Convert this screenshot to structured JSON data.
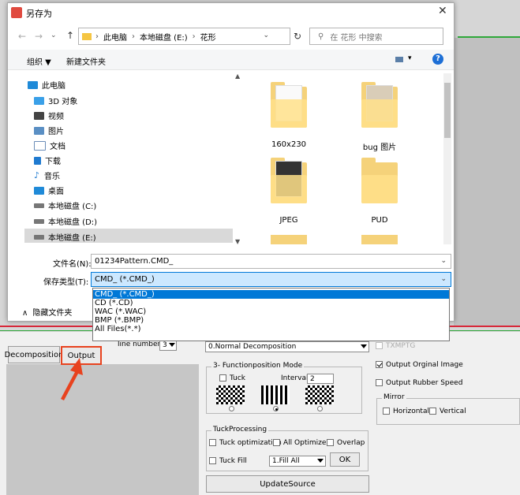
{
  "colors": {
    "accent_red": "#e8421e",
    "selection_blue": "#0078d7",
    "highlight_blue": "#cce8ff"
  },
  "dialog": {
    "title": "另存为",
    "breadcrumb": [
      "此电脑",
      "本地磁盘 (E:)",
      "花形"
    ],
    "search_placeholder": "在 花形 中搜索",
    "toolbar": {
      "organize": "组织 ▼",
      "new_folder": "新建文件夹"
    },
    "nav_items": [
      {
        "label": "此电脑",
        "icon": "computer-icon"
      },
      {
        "label": "3D 对象",
        "icon": "3d-objects-icon"
      },
      {
        "label": "视频",
        "icon": "video-icon"
      },
      {
        "label": "图片",
        "icon": "pictures-icon"
      },
      {
        "label": "文档",
        "icon": "documents-icon"
      },
      {
        "label": "下载",
        "icon": "download-icon"
      },
      {
        "label": "音乐",
        "icon": "music-icon"
      },
      {
        "label": "桌面",
        "icon": "desktop-icon"
      },
      {
        "label": "本地磁盘 (C:)",
        "icon": "drive-icon"
      },
      {
        "label": "本地磁盘 (D:)",
        "icon": "drive-icon"
      },
      {
        "label": "本地磁盘 (E:)",
        "icon": "drive-icon"
      }
    ],
    "folders": [
      {
        "label": "160x230"
      },
      {
        "label": "bug 图片"
      },
      {
        "label": "JPEG"
      },
      {
        "label": "PUD"
      }
    ],
    "filename_label": "文件名(N):",
    "filename_value": "01234Pattern.CMD_",
    "filetype_label": "保存类型(T):",
    "filetype_value": "CMD_ (*.CMD_)",
    "filetype_options": [
      "CMD_ (*.CMD_)",
      "CD (*.CD)",
      "WAC (*.WAC)",
      "BMP (*.BMP)",
      "All Files(*.*)"
    ],
    "hide_folders": "隐藏文件夹"
  },
  "app": {
    "decomposition_button": "Decomposition",
    "output_button": "Output",
    "line_numbers_label": "line numbers",
    "line_numbers_value": "3",
    "decomp_mode_value": "0.Normal Decomposition",
    "function_position_title": "3- Functionposition Mode",
    "tuck_label": "Tuck",
    "interval_label": "Interval",
    "interval_value": "2",
    "tuck_processing_title": "TuckProcessing",
    "tuck_optimization": "Tuck optimization",
    "all_optimize": "All Optimize",
    "overlap": "Overlap",
    "tuck_fill": "Tuck Fill",
    "fill_value": "1.Fill All",
    "ok_button": "OK",
    "update_source_button": "UpdateSource",
    "txmpg_label": "TXMPTG",
    "output_original_image": "Output Orginal Image",
    "output_rubber_speed": "Output Rubber Speed",
    "mirror_title": "Mirror",
    "horizontal": "Horizontal",
    "vertical": "Vertical"
  }
}
